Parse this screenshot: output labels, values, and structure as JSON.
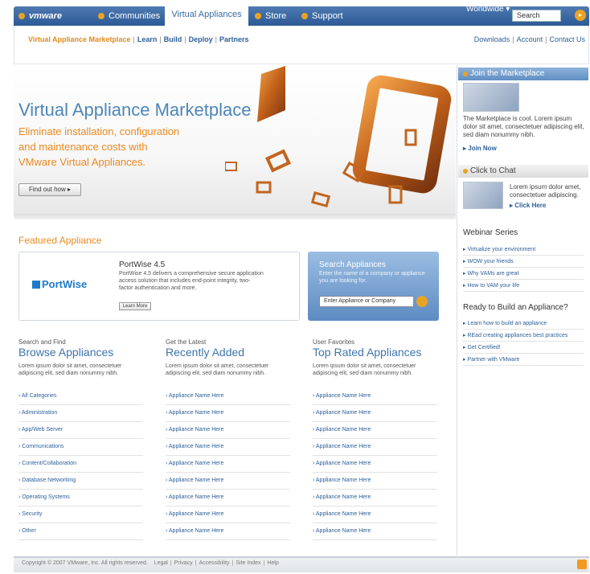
{
  "nav": {
    "logo": "vmware",
    "items": [
      "Communities",
      "Store",
      "Support"
    ],
    "active_tab": "Virtual Appliances",
    "worldwide": "Worldwide ▾",
    "search_placeholder": "Search",
    "accent": "#e9a324",
    "bar_color": "#3a6aa3"
  },
  "subnav": {
    "current": "Virtual Appliance Marketplace",
    "links": [
      "Learn",
      "Build",
      "Deploy",
      "Partners"
    ],
    "utility": [
      "Downloads",
      "Account",
      "Contact Us"
    ]
  },
  "hero": {
    "title": "Virtual Appliance Marketplace",
    "subtitle_lines": [
      "Eliminate installation, configuration",
      "and maintenance costs with",
      "VMware Virtual Appliances."
    ],
    "button": "Find out how ▸"
  },
  "featured": {
    "heading": "Featured Appliance",
    "logo_text": "PortWise",
    "product_title": "PortWise 4.5",
    "description": "PortWise 4.5 delivers a comprehensive secure application access solution that includes end-point integrity, two-factor authentication and more.",
    "learn_more": "Learn More"
  },
  "search_appliances": {
    "title": "Search Appliances",
    "description": "Enter the name of a company or appliance you are looking for.",
    "placeholder": "Enter Appliance or Company"
  },
  "columns": [
    {
      "small": "Search and Find",
      "big": "Browse Appliances",
      "desc": "Lorem ipsum dolor sit amet, consectetuer adipiscing elit, sed diam nonummy nibh.",
      "items": [
        "› All Categories",
        "› Administration",
        "› App/Web Server",
        "› Communications",
        "› Content/Collaboration",
        "› Database Networking",
        "› Operating Systems",
        "› Security",
        "› Other"
      ]
    },
    {
      "small": "Get the Latest",
      "big": "Recently Added",
      "desc": "Lorem ipsum dolor sit amet, consectetuer adipiscing elit, sed diam nonummy nibh.",
      "items": [
        "› Appliance Name Here",
        "› Appliance Name Here",
        "› Appliance Name Here",
        "› Appliance Name Here",
        "› Appliance Name Here",
        "› Appliance Name Here",
        "› Appliance Name Here",
        "› Appliance Name Here",
        "› Appliance Name Here"
      ]
    },
    {
      "small": "User Favorites",
      "big": "Top Rated Appliances",
      "desc": "Lorem ipsum dolor sit amet, consectetuer adipiscing elit, sed diam nonummy nibh.",
      "items": [
        "› Appliance Name Here",
        "› Appliance Name Here",
        "› Appliance Name Here",
        "› Appliance Name Here",
        "› Appliance Name Here",
        "› Appliance Name Here",
        "› Appliance Name Here",
        "› Appliance Name Here",
        "› Appliance Name Here"
      ]
    }
  ],
  "sidebar": {
    "join": {
      "title": "Join the Marketplace",
      "text": "The Marketplace is cool. Lorem ipsum dolor sit amet, consectetuer adipiscing elit, sed diam nonummy nibh.",
      "link": "▸ Join Now"
    },
    "chat": {
      "title": "Click to Chat",
      "text": "Lorem ipsum dolor amet, consectetuer adipiscing.",
      "link": "▸ Click Here"
    },
    "webinar": {
      "title": "Webinar Series",
      "items": [
        "▸ Virtualize your environment",
        "▸ WOW your friends",
        "▸ Why VAMs are great",
        "▸ How to VAM your life"
      ]
    },
    "build": {
      "title": "Ready to Build an Appliance?",
      "items": [
        "▸ Learn how to build an appliance",
        "▸ REad creating appliances best practices",
        "▸ Get Certified!",
        "▸ Partner with VMware"
      ]
    }
  },
  "footer": {
    "copyright": "Copyright © 2007 VMware, Inc. All rights reserved.",
    "links": [
      "Legal",
      "Privacy",
      "Accessibility",
      "Site Index",
      "Help"
    ]
  }
}
